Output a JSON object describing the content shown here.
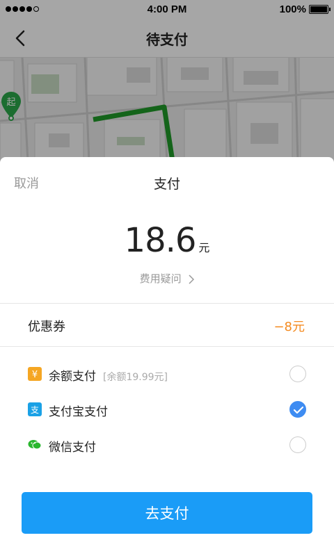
{
  "status_bar": {
    "time": "4:00 PM",
    "battery": "100%",
    "battery_level": 1.0
  },
  "nav": {
    "title": "待支付",
    "back_icon": "chevron-left-icon"
  },
  "map": {
    "start_pin_label": "起",
    "route_color": "#1f9a28"
  },
  "sheet": {
    "cancel_label": "取消",
    "title": "支付",
    "amount": "18.6",
    "amount_unit": "元",
    "fee_question": "费用疑问",
    "coupon": {
      "label": "优惠券",
      "value": "−8元",
      "value_color": "#f48a1f"
    },
    "payment_options": [
      {
        "label": "余额支付",
        "note": "[余额19.99元]",
        "icon": "balance-yuan-icon",
        "icon_color": "#f5a623",
        "selected": false
      },
      {
        "label": "支付宝支付",
        "note": "",
        "icon": "alipay-icon",
        "icon_color": "#1aa1e6",
        "selected": true
      },
      {
        "label": "微信支付",
        "note": "",
        "icon": "wechat-icon",
        "icon_color": "#2ab62e",
        "selected": false
      }
    ],
    "pay_button_label": "去支付",
    "accent_color": "#1a9cf7",
    "check_color": "#3e8cf2"
  }
}
